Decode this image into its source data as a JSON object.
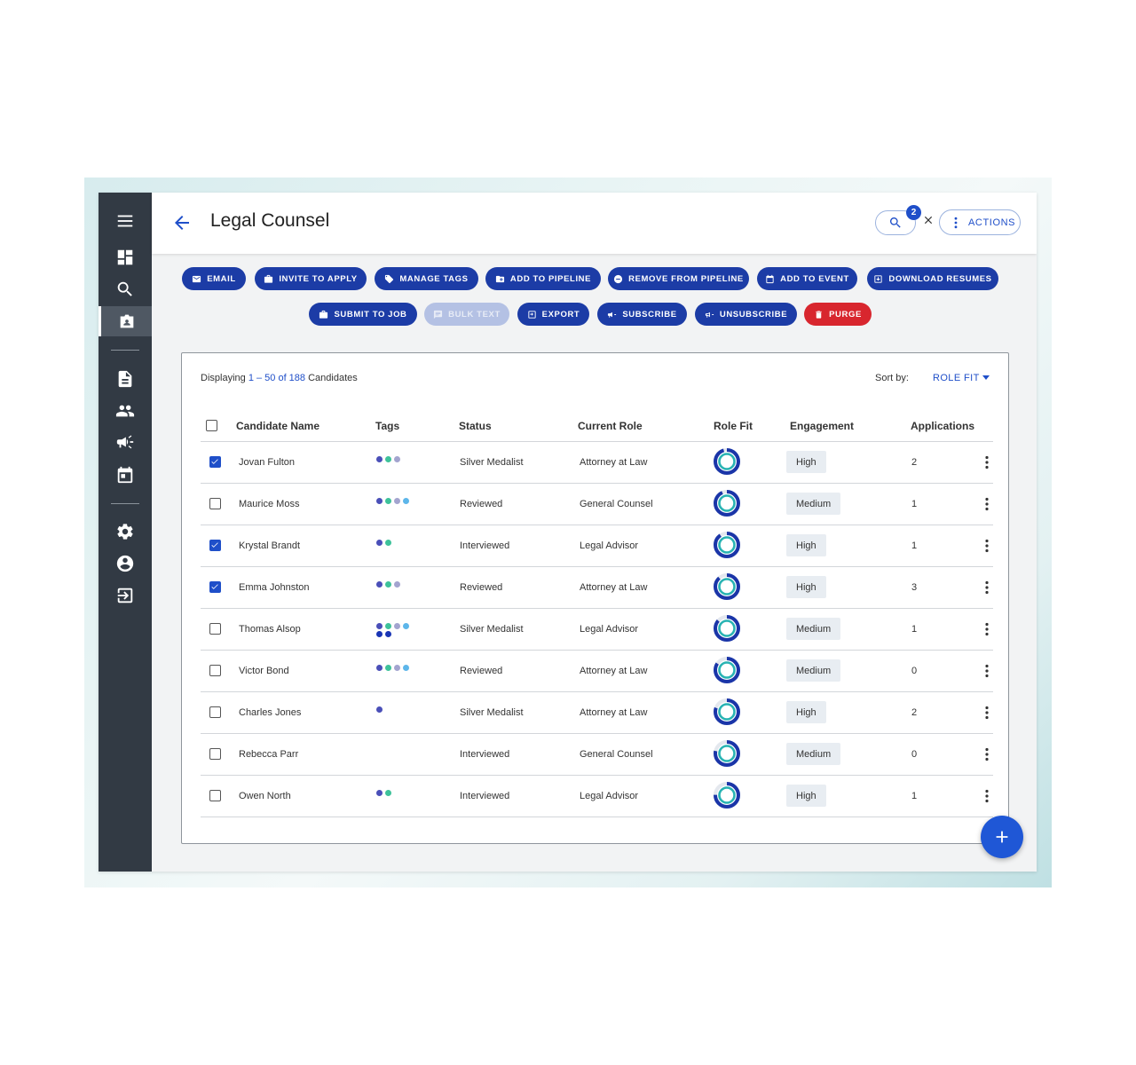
{
  "header": {
    "title": "Legal Counsel",
    "filter_count": "2",
    "actions_label": "ACTIONS"
  },
  "sidebar": {
    "items": [
      {
        "name": "menu-icon"
      },
      {
        "name": "dashboard-icon"
      },
      {
        "name": "search-icon"
      },
      {
        "name": "candidates-icon",
        "active": true
      },
      {
        "name": "document-icon"
      },
      {
        "name": "people-icon"
      },
      {
        "name": "megaphone-icon"
      },
      {
        "name": "calendar-icon"
      },
      {
        "name": "settings-icon"
      },
      {
        "name": "account-icon"
      },
      {
        "name": "logout-icon"
      }
    ]
  },
  "toolbar": {
    "row1": [
      "EMAIL",
      "INVITE TO APPLY",
      "MANAGE TAGS",
      "ADD TO PIPELINE",
      "REMOVE FROM PIPELINE",
      "ADD TO EVENT",
      "DOWNLOAD RESUMES"
    ],
    "row2": [
      "SUBMIT TO JOB",
      "BULK TEXT",
      "EXPORT",
      "SUBSCRIBE",
      "UNSUBSCRIBE",
      "PURGE"
    ],
    "disabled": [
      "BULK TEXT"
    ],
    "danger": [
      "PURGE"
    ]
  },
  "summary": {
    "prefix": "Displaying ",
    "range": "1 – 50 of 188",
    "suffix": " Candidates"
  },
  "sort": {
    "label": "Sort by:",
    "value": "ROLE FIT"
  },
  "columns": [
    "Candidate Name",
    "Tags",
    "Status",
    "Current Role",
    "Role Fit",
    "Engagement",
    "Applications"
  ],
  "tag_colors": {
    "indigo": "#4a4fb8",
    "teal": "#3ec29a",
    "lavender": "#a3a4cf",
    "sky": "#5db6ea",
    "navy": "#1a35b5"
  },
  "rows": [
    {
      "name": "Jovan Fulton",
      "checked": true,
      "tags": [
        "indigo",
        "teal",
        "lavender"
      ],
      "status": "Silver Medalist",
      "role": "Attorney at Law",
      "role_fit": 0.95,
      "engagement": "High",
      "applications": "2"
    },
    {
      "name": "Maurice Moss",
      "checked": false,
      "tags": [
        "indigo",
        "teal",
        "lavender",
        "sky"
      ],
      "status": "Reviewed",
      "role": "General Counsel",
      "role_fit": 0.93,
      "engagement": "Medium",
      "applications": "1"
    },
    {
      "name": "Krystal Brandt",
      "checked": true,
      "tags": [
        "indigo",
        "teal"
      ],
      "status": "Interviewed",
      "role": "Legal Advisor",
      "role_fit": 0.9,
      "engagement": "High",
      "applications": "1"
    },
    {
      "name": "Emma Johnston",
      "checked": true,
      "tags": [
        "indigo",
        "teal",
        "lavender"
      ],
      "status": "Reviewed",
      "role": "Attorney at Law",
      "role_fit": 0.88,
      "engagement": "High",
      "applications": "3"
    },
    {
      "name": "Thomas Alsop",
      "checked": false,
      "tags": [
        "indigo",
        "teal",
        "lavender",
        "sky",
        "navy",
        "navy"
      ],
      "status": "Silver Medalist",
      "role": "Legal Advisor",
      "role_fit": 0.86,
      "engagement": "Medium",
      "applications": "1"
    },
    {
      "name": "Victor Bond",
      "checked": false,
      "tags": [
        "indigo",
        "teal",
        "lavender",
        "sky"
      ],
      "status": "Reviewed",
      "role": "Attorney at Law",
      "role_fit": 0.84,
      "engagement": "Medium",
      "applications": "0"
    },
    {
      "name": "Charles Jones",
      "checked": false,
      "tags": [
        "indigo"
      ],
      "status": "Silver Medalist",
      "role": "Attorney at Law",
      "role_fit": 0.8,
      "engagement": "High",
      "applications": "2"
    },
    {
      "name": "Rebecca Parr",
      "checked": false,
      "tags": [],
      "status": "Interviewed",
      "role": "General Counsel",
      "role_fit": 0.78,
      "engagement": "Medium",
      "applications": "0"
    },
    {
      "name": "Owen North",
      "checked": false,
      "tags": [
        "indigo",
        "teal"
      ],
      "status": "Interviewed",
      "role": "Legal Advisor",
      "role_fit": 0.75,
      "engagement": "High",
      "applications": "1"
    }
  ]
}
